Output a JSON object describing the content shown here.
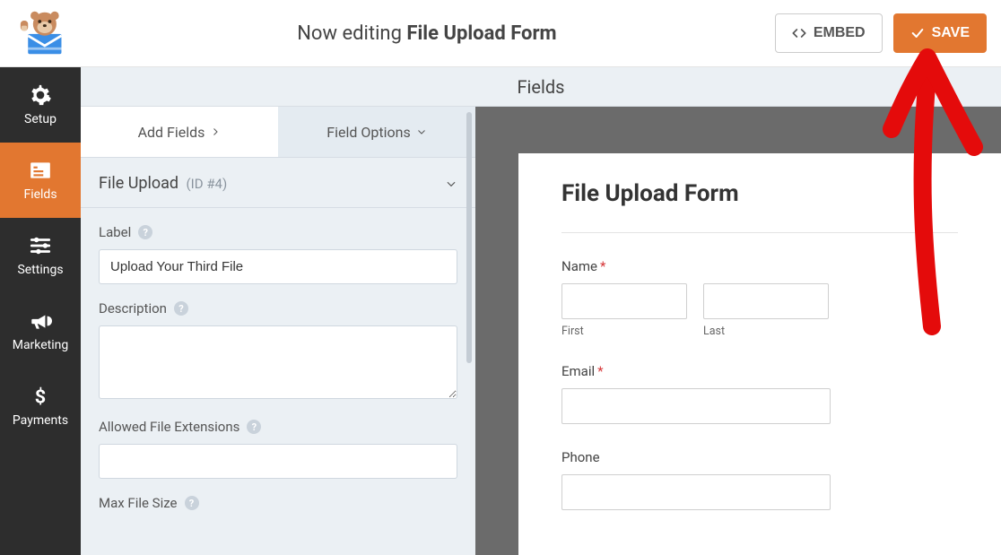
{
  "header": {
    "now_editing_prefix": "Now editing ",
    "form_name": "File Upload Form",
    "embed_label": "EMBED",
    "save_label": "SAVE"
  },
  "sidebar": {
    "items": [
      {
        "key": "setup",
        "label": "Setup"
      },
      {
        "key": "fields",
        "label": "Fields"
      },
      {
        "key": "settings",
        "label": "Settings"
      },
      {
        "key": "marketing",
        "label": "Marketing"
      },
      {
        "key": "payments",
        "label": "Payments"
      }
    ],
    "active_key": "fields"
  },
  "center": {
    "title": "Fields"
  },
  "panel": {
    "tab_add_label": "Add Fields",
    "tab_options_label": "Field Options",
    "field_name": "File Upload",
    "field_id_text": "(ID #4)",
    "label_heading": "Label",
    "label_value": "Upload Your Third File",
    "description_heading": "Description",
    "description_value": "",
    "extensions_heading": "Allowed File Extensions",
    "extensions_value": "",
    "maxsize_heading": "Max File Size"
  },
  "preview": {
    "title": "File Upload Form",
    "name_label": "Name",
    "first_sub": "First",
    "last_sub": "Last",
    "email_label": "Email",
    "phone_label": "Phone"
  }
}
